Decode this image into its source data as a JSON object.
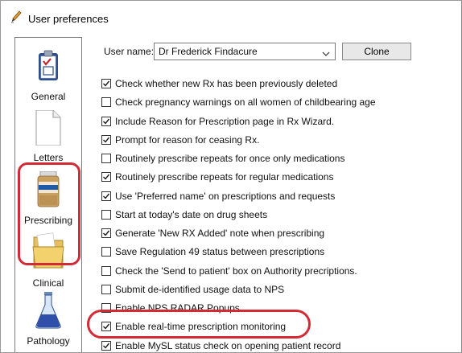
{
  "window": {
    "title": "User preferences",
    "title_icon": "pen-icon"
  },
  "sidebar": {
    "items": [
      {
        "label": "General",
        "icon": "clipboard-checklist-icon"
      },
      {
        "label": "Letters",
        "icon": "document-page-icon"
      },
      {
        "label": "Prescribing",
        "icon": "medicine-bottle-icon",
        "selected": true
      },
      {
        "label": "Clinical",
        "icon": "folder-icon"
      },
      {
        "label": "Pathology",
        "icon": "flask-icon"
      }
    ]
  },
  "user": {
    "label": "User name:",
    "selected": "Dr Frederick Findacure",
    "clone_label": "Clone"
  },
  "options": [
    {
      "label": "Check whether new Rx has been previously deleted",
      "checked": true
    },
    {
      "label": "Check pregnancy warnings on all women of childbearing age",
      "checked": false
    },
    {
      "label": "Include Reason for Prescription page in Rx Wizard.",
      "checked": true
    },
    {
      "label": "Prompt for reason for ceasing Rx.",
      "checked": true
    },
    {
      "label": "Routinely prescribe repeats for once only medications",
      "checked": false
    },
    {
      "label": "Routinely prescribe repeats for regular medications",
      "checked": true
    },
    {
      "label": "Use 'Preferred name' on prescriptions and requests",
      "checked": true
    },
    {
      "label": "Start at today's date on drug sheets",
      "checked": false
    },
    {
      "label": "Generate 'New RX Added' note when prescribing",
      "checked": true
    },
    {
      "label": "Save Regulation 49 status between prescriptions",
      "checked": false
    },
    {
      "label": "Check the 'Send to patient' box on Authority precriptions.",
      "checked": false
    },
    {
      "label": "Submit de-identified usage data to NPS",
      "checked": false
    },
    {
      "label": "Enable NPS RADAR Popups",
      "checked": false
    },
    {
      "label": "Enable real-time prescription monitoring",
      "checked": true
    },
    {
      "label": "Enable MySL status check on opening patient record",
      "checked": true
    }
  ],
  "colors": {
    "annotation": "#d42a36",
    "check": "#1a1a1a"
  }
}
